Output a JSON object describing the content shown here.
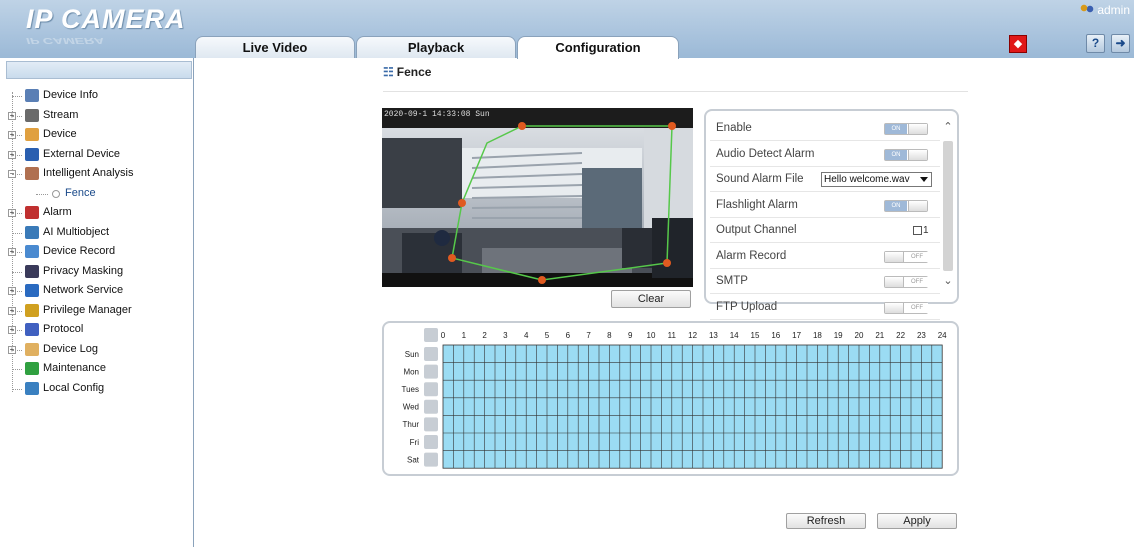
{
  "app": {
    "logo": "IP CAMERA",
    "logo_reflection": "IP CAMERA",
    "user": "admin"
  },
  "tabs": [
    {
      "label": "Live Video",
      "active": false
    },
    {
      "label": "Playback",
      "active": false
    },
    {
      "label": "Configuration",
      "active": true
    }
  ],
  "header_icons": {
    "alarm": "alarm-bell-icon",
    "help": "help-icon",
    "logout": "logout-icon"
  },
  "sidebar": {
    "items": [
      {
        "label": "Device Info",
        "icon": "device-info-icon",
        "expandable": false,
        "color": "#5a7fb5"
      },
      {
        "label": "Stream",
        "icon": "stream-icon",
        "expandable": true,
        "color": "#6a6a6a"
      },
      {
        "label": "Device",
        "icon": "device-icon",
        "expandable": true,
        "color": "#e0a040"
      },
      {
        "label": "External Device",
        "icon": "external-device-icon",
        "expandable": true,
        "color": "#2a5fb0"
      },
      {
        "label": "Intelligent Analysis",
        "icon": "intelligent-analysis-icon",
        "expandable": true,
        "expanded": true,
        "color": "#b07050"
      },
      {
        "label": "Fence",
        "icon": "fence-node-icon",
        "child": true,
        "selected": true
      },
      {
        "label": "Alarm",
        "icon": "alarm-icon",
        "expandable": true,
        "color": "#c03030"
      },
      {
        "label": "AI Multiobject",
        "icon": "ai-multiobject-icon",
        "expandable": false,
        "color": "#3a7ab8"
      },
      {
        "label": "Device Record",
        "icon": "device-record-icon",
        "expandable": true,
        "color": "#4a8ad0"
      },
      {
        "label": "Privacy Masking",
        "icon": "privacy-masking-icon",
        "expandable": false,
        "color": "#3a3a5a"
      },
      {
        "label": "Network Service",
        "icon": "network-service-icon",
        "expandable": true,
        "color": "#2a6ac0"
      },
      {
        "label": "Privilege Manager",
        "icon": "privilege-manager-icon",
        "expandable": true,
        "color": "#d0a020"
      },
      {
        "label": "Protocol",
        "icon": "protocol-icon",
        "expandable": true,
        "color": "#4060c0"
      },
      {
        "label": "Device Log",
        "icon": "device-log-icon",
        "expandable": true,
        "color": "#e0b060"
      },
      {
        "label": "Maintenance",
        "icon": "maintenance-icon",
        "expandable": false,
        "color": "#30a040"
      },
      {
        "label": "Local Config",
        "icon": "local-config-icon",
        "expandable": false,
        "color": "#3a80c0"
      }
    ]
  },
  "page": {
    "title": "Fence",
    "title_icon": "fence-icon"
  },
  "video": {
    "osd": "2020-09-1  14:33:08 Sun",
    "clear_label": "Clear"
  },
  "settings": [
    {
      "label": "Enable",
      "type": "toggle",
      "state": "ON"
    },
    {
      "label": "Audio Detect Alarm",
      "type": "toggle",
      "state": "ON"
    },
    {
      "label": "Sound Alarm File",
      "type": "select",
      "value": "Hello welcome.wav"
    },
    {
      "label": "Flashlight Alarm",
      "type": "toggle",
      "state": "ON"
    },
    {
      "label": "Output Channel",
      "type": "checkbox",
      "checked": false,
      "option": "1"
    },
    {
      "label": "Alarm Record",
      "type": "toggle",
      "state": "OFF"
    },
    {
      "label": "SMTP",
      "type": "toggle",
      "state": "OFF"
    },
    {
      "label": "FTP Upload",
      "type": "toggle",
      "state": "OFF"
    }
  ],
  "schedule": {
    "hours": [
      "0",
      "1",
      "2",
      "3",
      "4",
      "5",
      "6",
      "7",
      "8",
      "9",
      "10",
      "11",
      "12",
      "13",
      "14",
      "15",
      "16",
      "17",
      "18",
      "19",
      "20",
      "21",
      "22",
      "23",
      "24"
    ],
    "days": [
      "Sun",
      "Mon",
      "Tues",
      "Wed",
      "Thur",
      "Fri",
      "Sat"
    ],
    "cell_color": "#9bdcf3",
    "all_selected": true
  },
  "buttons": {
    "refresh": "Refresh",
    "apply": "Apply"
  }
}
